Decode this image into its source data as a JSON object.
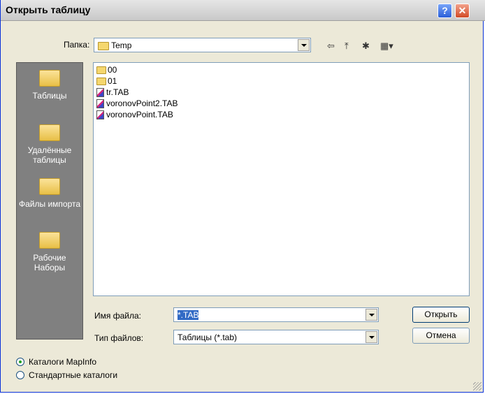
{
  "window": {
    "title": "Открыть таблицу"
  },
  "titlebar": {
    "help_glyph": "?",
    "close_glyph": "✕"
  },
  "lookin": {
    "label": "Папка:",
    "value": "Temp"
  },
  "toolbar": {
    "back_glyph": "⇦",
    "up_glyph": "⤒",
    "newfolder_glyph": "✱",
    "view_glyph": "▦▾"
  },
  "sidebar": {
    "items": [
      {
        "label": "Таблицы"
      },
      {
        "label": "Удалённые таблицы"
      },
      {
        "label": "Файлы импорта"
      },
      {
        "label": "Рабочие Наборы"
      }
    ]
  },
  "files": [
    {
      "name": "00",
      "type": "folder"
    },
    {
      "name": "01",
      "type": "folder"
    },
    {
      "name": "tr.TAB",
      "type": "tab"
    },
    {
      "name": "voronovPoint2.TAB",
      "type": "tab"
    },
    {
      "name": "voronovPoint.TAB",
      "type": "tab"
    }
  ],
  "filename": {
    "label": "Имя файла:",
    "value": "*.TAB"
  },
  "filetype": {
    "label": "Тип файлов:",
    "value": "Таблицы (*.tab)"
  },
  "buttons": {
    "open": "Открыть",
    "cancel": "Отмена"
  },
  "radios": [
    {
      "label": "Каталоги MapInfo",
      "checked": true
    },
    {
      "label": "Стандартные каталоги",
      "checked": false
    }
  ]
}
